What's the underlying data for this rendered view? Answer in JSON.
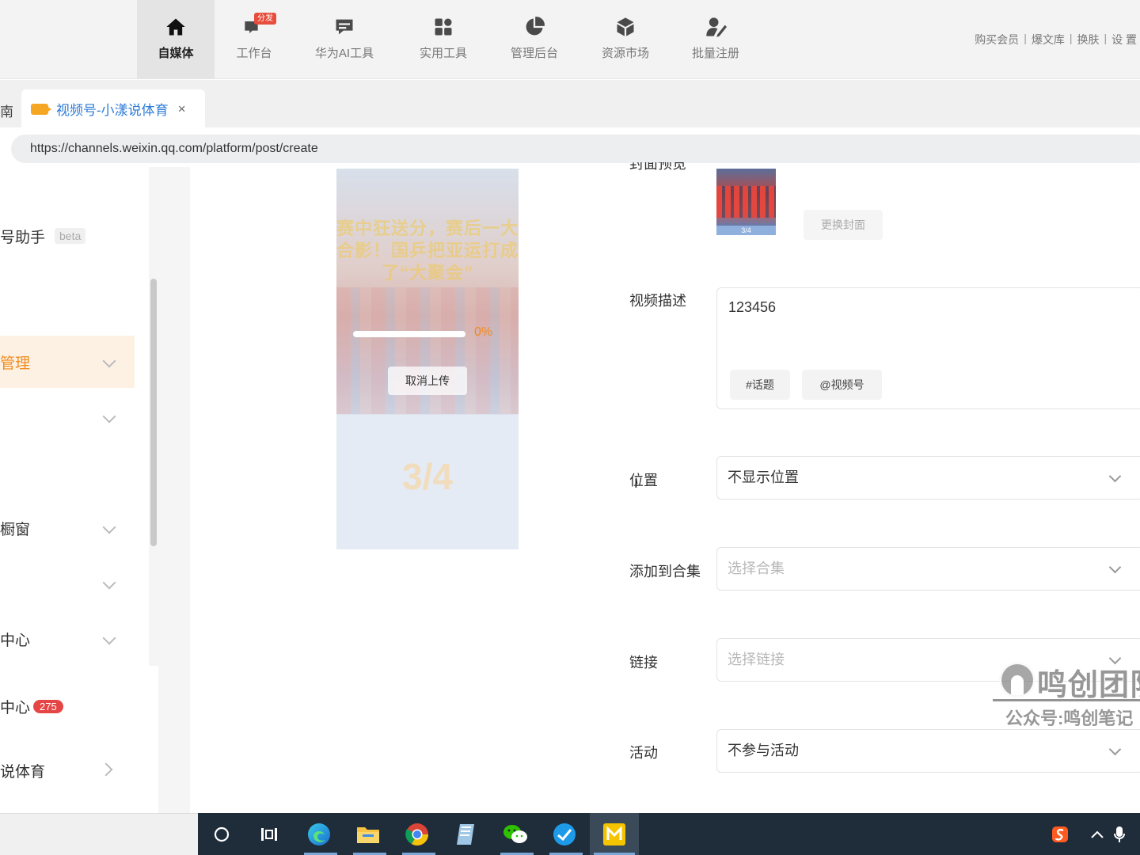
{
  "toolbar": {
    "items": [
      {
        "label": "自媒体",
        "icon": "home-icon",
        "active": true
      },
      {
        "label": "工作台",
        "icon": "workbench-icon",
        "badge": "分发"
      },
      {
        "label": "华为AI工具",
        "icon": "chat-icon"
      },
      {
        "label": "实用工具",
        "icon": "apps-grid-icon"
      },
      {
        "label": "管理后台",
        "icon": "pie-chart-icon"
      },
      {
        "label": "资源市场",
        "icon": "box-icon"
      },
      {
        "label": "批量注册",
        "icon": "user-edit-icon"
      }
    ],
    "links": [
      "购买会员",
      "爆文库",
      "换肤",
      "设 置"
    ],
    "separator": "|"
  },
  "tabs": {
    "prev_partial": "南",
    "active_title": "视频号-小漾说体育",
    "close_glyph": "×"
  },
  "address": {
    "url": "https://channels.weixin.qq.com/platform/post/create"
  },
  "sidebar": {
    "items": [
      {
        "label": "号助手",
        "badge": "beta"
      },
      {
        "label": "管理",
        "active": true
      },
      {
        "label": ""
      },
      {
        "label": "橱窗"
      },
      {
        "label": ""
      },
      {
        "label": "中心"
      },
      {
        "label": "中心",
        "count": "275"
      },
      {
        "label": "说体育"
      }
    ]
  },
  "preview": {
    "headline": "赛中狂送分，赛后一大合影！国乒把亚运打成了“大聚会”",
    "progress_percent": "0%",
    "progress_value": 0,
    "cancel_label": "取消上传",
    "page_indicator": "3/4"
  },
  "form": {
    "cover_label_partial": "封面预览",
    "cover_badge": "3/4",
    "change_cover_label": "更换封面",
    "description_label": "视频描述",
    "description_value": "123456",
    "topic_chip": "#话题",
    "mention_chip": "@视频号",
    "location_label": "位置",
    "location_value": "不显示位置",
    "collection_label": "添加到合集",
    "collection_placeholder": "选择合集",
    "link_label": "链接",
    "link_placeholder": "选择链接",
    "activity_label": "活动",
    "activity_value": "不参与活动"
  },
  "watermark": {
    "title": "鸣创团队",
    "subtitle": "公众号:鸣创笔记"
  },
  "taskbar": {
    "apps": [
      "search-circle-icon",
      "task-view-icon",
      "edge-icon",
      "file-explorer-icon",
      "chrome-icon",
      "notes-icon",
      "wechat-icon",
      "feishu-icon",
      "mango-app-icon"
    ],
    "tray": [
      "sogou-input-icon",
      "tray-chevron-icon",
      "microphone-icon"
    ]
  },
  "colors": {
    "accent_orange": "#f08c1f",
    "tab_title_blue": "#2d7bd8",
    "badge_red": "#e54545",
    "taskbar": "#1f2d3a"
  }
}
